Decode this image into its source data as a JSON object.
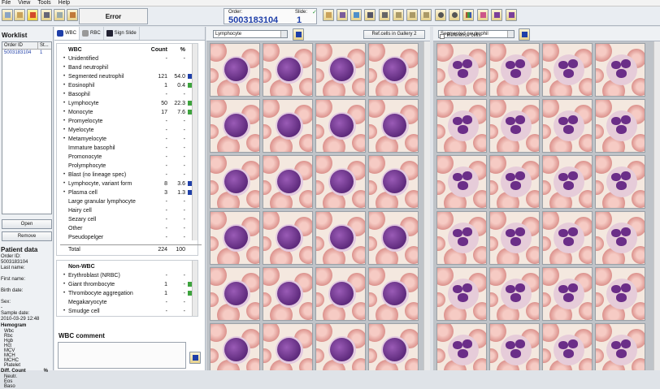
{
  "menu": [
    "File",
    "View",
    "Tools",
    "Help"
  ],
  "toolbar": {
    "error_label": "Error",
    "order_label": "Order:",
    "order_value": "5003183104",
    "slide_label": "Slide:",
    "slide_value": "1"
  },
  "worklist": {
    "title": "Worklist",
    "columns": [
      "Order ID",
      "St..."
    ],
    "rows": [
      {
        "order_id": "5003183104",
        "status": "1"
      }
    ],
    "open_button": "Open",
    "remove_button": "Remove"
  },
  "patient": {
    "title": "Patient data",
    "fields": [
      {
        "label": "Order ID:",
        "value": "5003183104"
      },
      {
        "label": "Last name:",
        "value": ""
      },
      {
        "label": "First name:",
        "value": ""
      },
      {
        "label": "Birth date:",
        "value": ""
      },
      {
        "label": "Sex:",
        "value": "-"
      },
      {
        "label": "Sample date:",
        "value": "2010-03-29 12:48"
      }
    ],
    "hemogram_title": "Hemogram",
    "hemogram": [
      "Wbc",
      "Rbc",
      "Hgb",
      "Hct",
      "MCV",
      "MCH",
      "MCHC",
      "Platelet"
    ],
    "diff_title": "Diff. Count",
    "diff_unit": "%",
    "diff": [
      "Neutr.",
      "Eos",
      "Baso"
    ]
  },
  "tabs": [
    "WBC",
    "RBC",
    "Sign Slide"
  ],
  "wbc": {
    "header": {
      "name": "WBC",
      "count": "Count",
      "pct": "%"
    },
    "rows": [
      {
        "name": "Unidentified",
        "count": "-",
        "pct": "-",
        "bullet": true,
        "color": ""
      },
      {
        "name": "Band neutrophil",
        "count": "",
        "pct": "",
        "bullet": true,
        "color": ""
      },
      {
        "name": "Segmented neutrophil",
        "count": "121",
        "pct": "54.0",
        "bullet": true,
        "color": "#1f3fa8"
      },
      {
        "name": "Eosinophil",
        "count": "1",
        "pct": "0.4",
        "bullet": true,
        "color": "#3da33d"
      },
      {
        "name": "Basophil",
        "count": "-",
        "pct": "-",
        "bullet": true,
        "color": ""
      },
      {
        "name": "Lymphocyte",
        "count": "50",
        "pct": "22.3",
        "bullet": true,
        "color": "#3da33d"
      },
      {
        "name": "Monocyte",
        "count": "17",
        "pct": "7.6",
        "bullet": true,
        "color": "#3da33d"
      },
      {
        "name": "Promyelocyte",
        "count": "-",
        "pct": "-",
        "bullet": true,
        "color": ""
      },
      {
        "name": "Myelocyte",
        "count": "-",
        "pct": "-",
        "bullet": true,
        "color": ""
      },
      {
        "name": "Metamyelocyte",
        "count": "-",
        "pct": "-",
        "bullet": true,
        "color": ""
      },
      {
        "name": "Immature basophil",
        "count": "-",
        "pct": "-",
        "bullet": false,
        "color": ""
      },
      {
        "name": "Promonocyte",
        "count": "-",
        "pct": "-",
        "bullet": false,
        "color": ""
      },
      {
        "name": "Prolymphocyte",
        "count": "-",
        "pct": "-",
        "bullet": false,
        "color": ""
      },
      {
        "name": "Blast (no lineage spec)",
        "count": "-",
        "pct": "-",
        "bullet": true,
        "color": ""
      },
      {
        "name": "Lymphocyte, variant form",
        "count": "8",
        "pct": "3.6",
        "bullet": true,
        "color": "#1f3fa8"
      },
      {
        "name": "Plasma cell",
        "count": "3",
        "pct": "1.3",
        "bullet": true,
        "color": "#1f3fa8"
      },
      {
        "name": "Large granular lymphocyte",
        "count": "-",
        "pct": "-",
        "bullet": false,
        "color": ""
      },
      {
        "name": "Hairy cell",
        "count": "-",
        "pct": "-",
        "bullet": false,
        "color": ""
      },
      {
        "name": "Sezary cell",
        "count": "-",
        "pct": "-",
        "bullet": false,
        "color": ""
      },
      {
        "name": "Other",
        "count": "-",
        "pct": "-",
        "bullet": false,
        "color": ""
      },
      {
        "name": "Pseudopelger",
        "count": "-",
        "pct": "-",
        "bullet": false,
        "color": ""
      }
    ],
    "total": {
      "name": "Total",
      "count": "224",
      "pct": "100"
    }
  },
  "nonwbc": {
    "header": "Non-WBC",
    "rows": [
      {
        "name": "Erythroblast (NRBC)",
        "count": "-",
        "pct": "-",
        "bullet": true,
        "color": ""
      },
      {
        "name": "Giant thrombocyte",
        "count": "1",
        "pct": "-",
        "bullet": true,
        "color": "#3da33d"
      },
      {
        "name": "Thrombocyte aggregation",
        "count": "1",
        "pct": "-",
        "bullet": true,
        "color": "#3da33d"
      },
      {
        "name": "Megakaryocyte",
        "count": "-",
        "pct": "-",
        "bullet": false,
        "color": ""
      },
      {
        "name": "Smudge cell",
        "count": "-",
        "pct": "-",
        "bullet": true,
        "color": ""
      }
    ]
  },
  "comment": {
    "title": "WBC comment"
  },
  "gallery1": {
    "select": "Lymphocyte",
    "button": "Ref.cells in Gallery 2",
    "cell_type": "lymphocyte"
  },
  "gallery2": {
    "select": "Segmented neutrophil",
    "checkbox": "Reference cells",
    "cell_type": "neutrophil"
  },
  "colors": {
    "accent": "#1f3fa8",
    "green": "#3da33d"
  }
}
